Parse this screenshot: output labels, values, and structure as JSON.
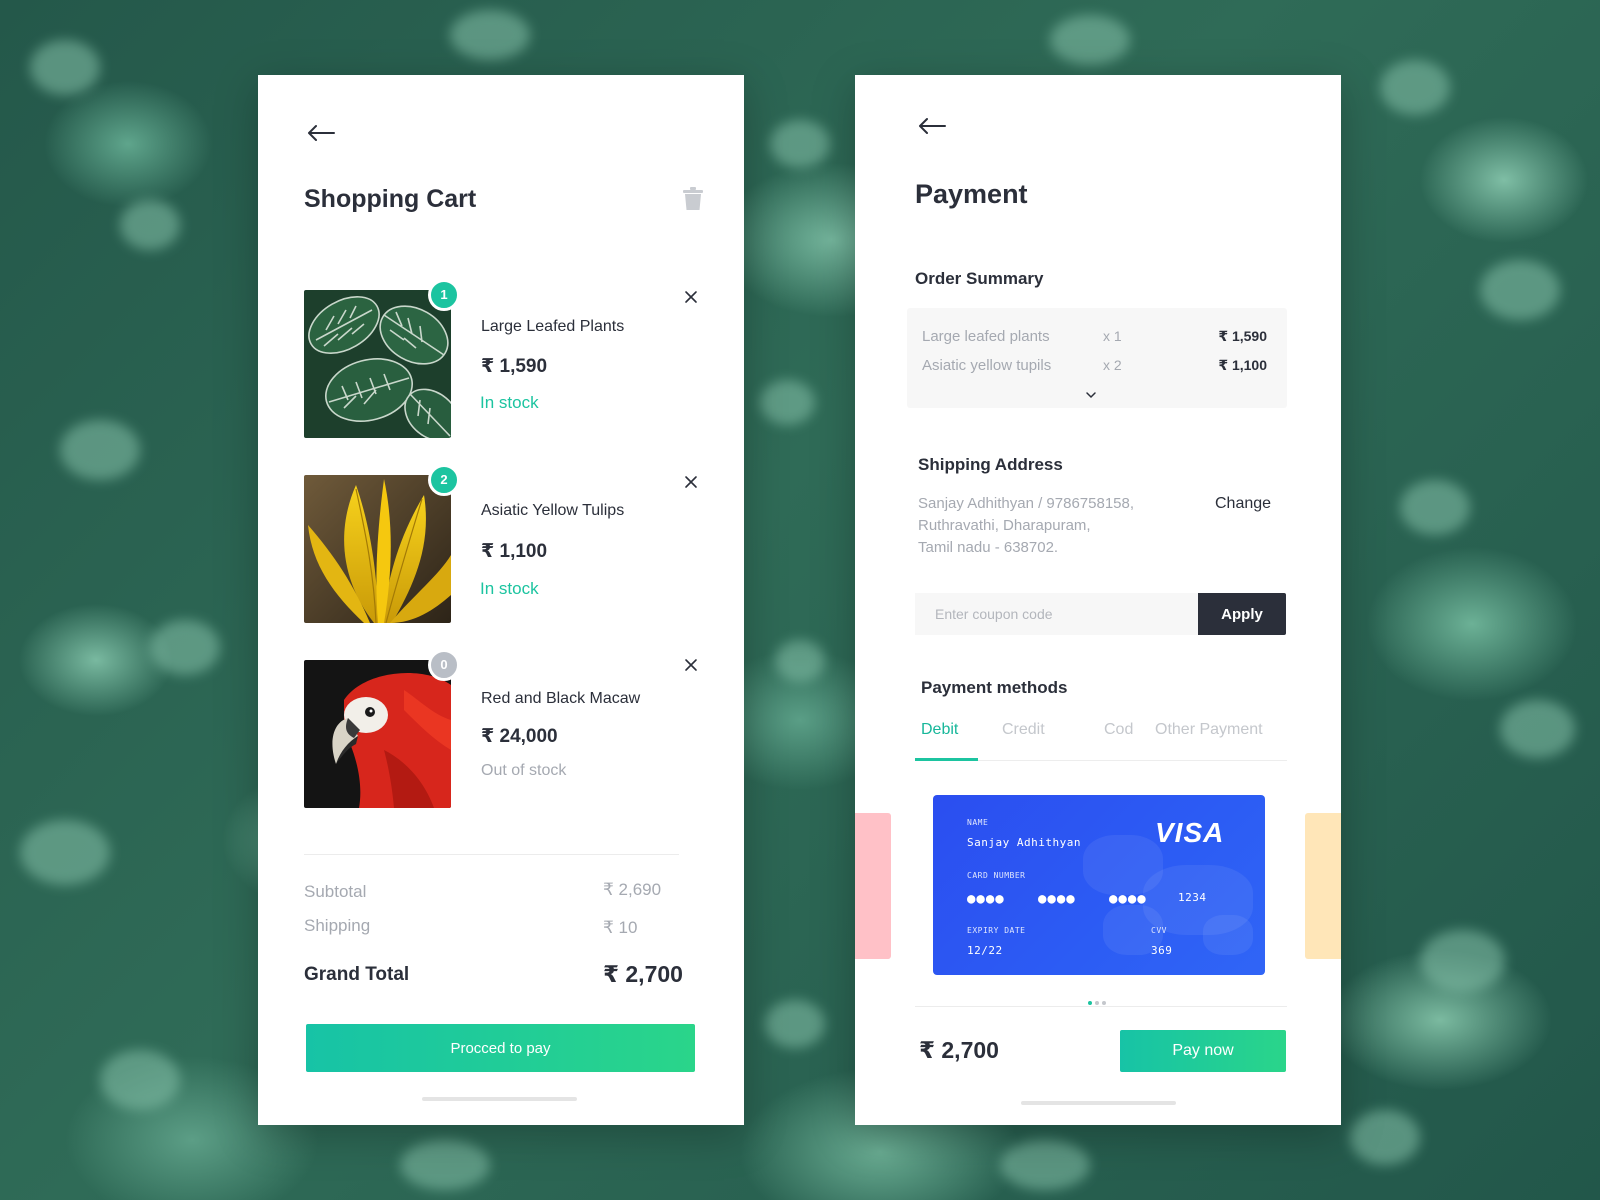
{
  "colors": {
    "accent_green": "#1cc4a0",
    "dark": "#2b2f3a",
    "muted": "#a5a9b1",
    "visa_blue": "#2c5cf4",
    "out_badge": "#b9bec6"
  },
  "cart": {
    "title": "Shopping Cart",
    "items": [
      {
        "badge": "1",
        "name": "Large Leafed Plants",
        "price": "₹ 1,590",
        "stock": "In stock",
        "in_stock": true,
        "image": "striped-leaf-plant"
      },
      {
        "badge": "2",
        "name": "Asiatic Yellow Tulips",
        "price": "₹ 1,100",
        "stock": "In stock",
        "in_stock": true,
        "image": "yellow-tulip"
      },
      {
        "badge": "0",
        "name": "Red and Black Macaw",
        "price": "₹ 24,000",
        "stock": "Out of stock",
        "in_stock": false,
        "image": "red-macaw"
      }
    ],
    "subtotal_label": "Subtotal",
    "subtotal_value": "₹ 2,690",
    "shipping_label": "Shipping",
    "shipping_value": "₹ 10",
    "grand_total_label": "Grand Total",
    "grand_total_value": "₹ 2,700",
    "proceed_label": "Procced to pay"
  },
  "payment": {
    "title": "Payment",
    "order_summary_title": "Order Summary",
    "order_rows": [
      {
        "name": "Large leafed plants",
        "qty": "x 1",
        "price": "₹ 1,590"
      },
      {
        "name": "Asiatic yellow tupils",
        "qty": "x 2",
        "price": "₹ 1,100"
      }
    ],
    "shipping_title": "Shipping Address",
    "address_lines": [
      "Sanjay Adhithyan / 9786758158,",
      "Ruthravathi, Dharapuram,",
      "Tamil nadu - 638702."
    ],
    "change_label": "Change",
    "coupon_placeholder": "Enter coupon code",
    "apply_label": "Apply",
    "methods_title": "Payment methods",
    "tabs": [
      "Debit",
      "Credit",
      "Cod",
      "Other Payment"
    ],
    "active_tab": "Debit",
    "card": {
      "name_label": "NAME",
      "name": "Sanjay Adhithyan",
      "number_label": "CARD NUMBER",
      "number_masked": [
        "●●●●",
        "●●●●",
        "●●●●"
      ],
      "number_last": "1234",
      "expiry_label": "EXPIRY DATE",
      "expiry": "12/22",
      "cvv_label": "CVV",
      "cvv": "369",
      "brand": "VISA"
    },
    "total": "₹ 2,700",
    "pay_label": "Pay now"
  }
}
